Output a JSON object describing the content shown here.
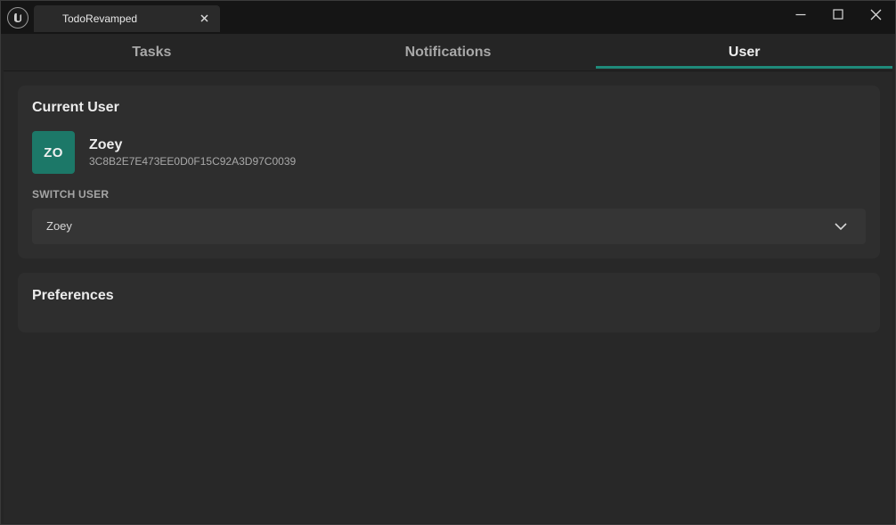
{
  "window": {
    "tab_title": "TodoRevamped",
    "close_tab_icon": "close-icon",
    "controls": [
      "minimize-icon",
      "maximize-icon",
      "close-icon"
    ]
  },
  "main_tabs": [
    {
      "label": "Tasks",
      "active": false
    },
    {
      "label": "Notifications",
      "active": false
    },
    {
      "label": "User",
      "active": true
    }
  ],
  "current_user": {
    "title": "Current User",
    "initials": "ZO",
    "name": "Zoey",
    "id": "3C8B2E7E473EE0D0F15C92A3D97C0039"
  },
  "switch_user": {
    "label": "SWITCH USER",
    "selected": "Zoey"
  },
  "preferences": {
    "title": "Preferences"
  },
  "colors": {
    "accent": "#1f8a7a",
    "avatar": "#1c7868",
    "background": "#252525",
    "card": "#2e2e2e"
  }
}
